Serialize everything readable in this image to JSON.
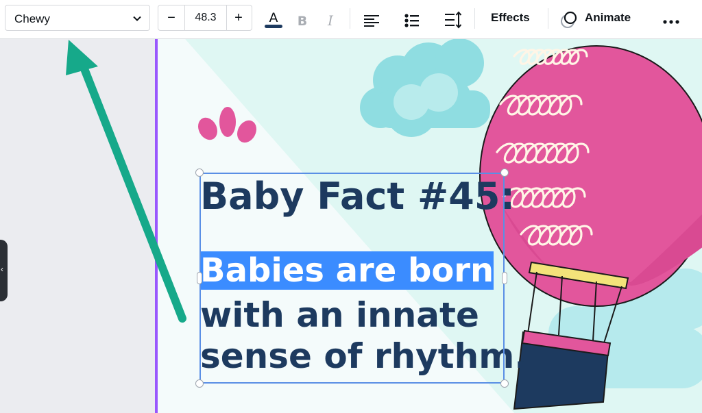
{
  "toolbar": {
    "font_family": "Chewy",
    "font_size": "48.3",
    "decrease_label": "−",
    "increase_label": "+",
    "effects_label": "Effects",
    "animate_label": "Animate",
    "text_color": "#1d3a5f"
  },
  "design": {
    "heading": "Baby Fact #45:",
    "highlighted_line": "Babies are born",
    "line_2": "with an innate",
    "line_3": "sense of rhythm.",
    "colors": {
      "text": "#1d3a5f",
      "highlight": "#3b8cff",
      "balloon": "#e2569c",
      "cloud": "#8fdde1",
      "arrow": "#16a98a"
    }
  },
  "side_tab_glyph": "‹"
}
